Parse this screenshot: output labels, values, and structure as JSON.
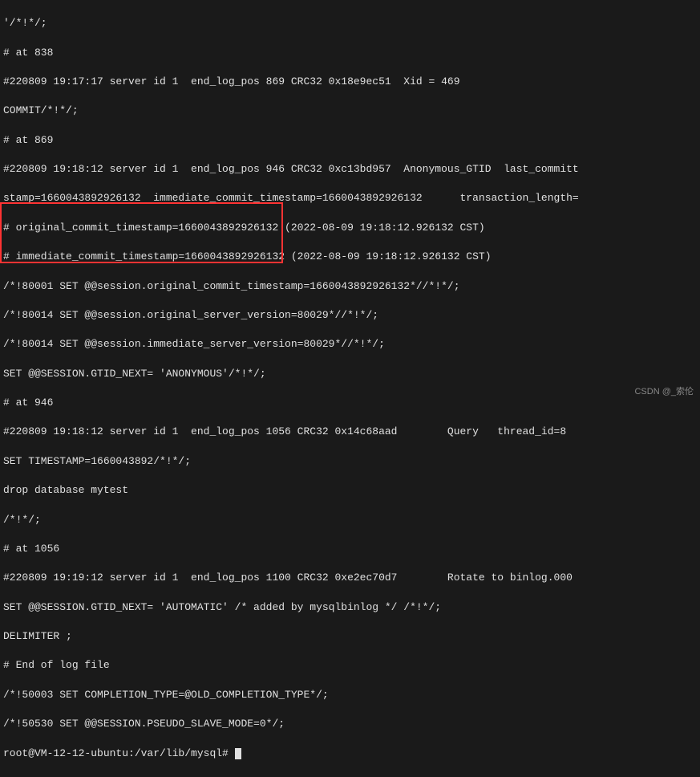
{
  "lines": {
    "l0": "'/*!*/;",
    "l1": "# at 838",
    "l2": "#220809 19:17:17 server id 1  end_log_pos 869 CRC32 0x18e9ec51  Xid = 469",
    "l3": "COMMIT/*!*/;",
    "l4": "# at 869",
    "l5": "#220809 19:18:12 server id 1  end_log_pos 946 CRC32 0xc13bd957  Anonymous_GTID  last_committ",
    "l6": "stamp=1660043892926132  immediate_commit_timestamp=1660043892926132      transaction_length=",
    "l7": "# original_commit_timestamp=1660043892926132 (2022-08-09 19:18:12.926132 CST)",
    "l8": "# immediate_commit_timestamp=1660043892926132 (2022-08-09 19:18:12.926132 CST)",
    "l9": "/*!80001 SET @@session.original_commit_timestamp=1660043892926132*//*!*/;",
    "l10": "/*!80014 SET @@session.original_server_version=80029*//*!*/;",
    "l11": "/*!80014 SET @@session.immediate_server_version=80029*//*!*/;",
    "l12": "SET @@SESSION.GTID_NEXT= 'ANONYMOUS'/*!*/;",
    "l13": "# at 946",
    "l14": "#220809 19:18:12 server id 1  end_log_pos 1056 CRC32 0x14c68aad        Query   thread_id=8",
    "l15": "SET TIMESTAMP=1660043892/*!*/;",
    "l16": "drop database mytest",
    "l17": "/*!*/;",
    "l18": "# at 1056",
    "l19": "#220809 19:19:12 server id 1  end_log_pos 1100 CRC32 0xe2ec70d7        Rotate to binlog.000",
    "l20": "SET @@SESSION.GTID_NEXT= 'AUTOMATIC' /* added by mysqlbinlog */ /*!*/;",
    "l21": "DELIMITER ;",
    "l22": "# End of log file",
    "l23": "/*!50003 SET COMPLETION_TYPE=@OLD_COMPLETION_TYPE*/;",
    "l24": "/*!50530 SET @@SESSION.PSEUDO_SLAVE_MODE=0*/;",
    "prompt": "root@VM-12-12-ubuntu:/var/lib/mysql# "
  },
  "watermark": "CSDN @_索伦"
}
